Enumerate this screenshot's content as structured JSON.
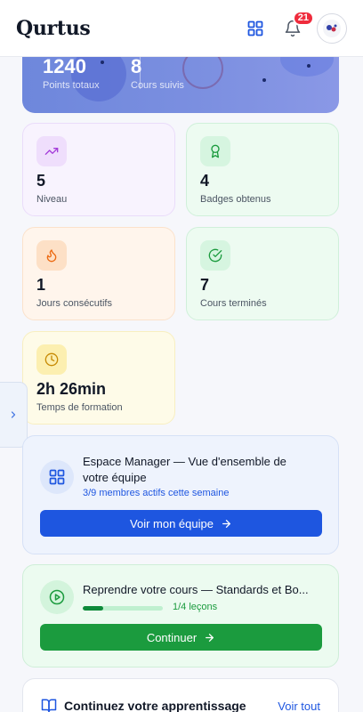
{
  "header": {
    "brand": "Qurtus",
    "notification_count": "21",
    "icons": {
      "apps": "grid-icon",
      "notifications": "bell-icon",
      "avatar": "avatar-logo"
    }
  },
  "hero": {
    "total_points_value": "1240",
    "total_points_label": "Points totaux",
    "courses_followed_value": "8",
    "courses_followed_label": "Cours suivis"
  },
  "stats": {
    "level": {
      "value": "5",
      "label": "Niveau",
      "icon": "trending-up-icon"
    },
    "badges": {
      "value": "4",
      "label": "Badges obtenus",
      "icon": "award-icon"
    },
    "streak": {
      "value": "1",
      "label": "Jours consécutifs",
      "icon": "flame-icon"
    },
    "completed": {
      "value": "7",
      "label": "Cours terminés",
      "icon": "check-circle-icon"
    },
    "training_time": {
      "value": "2h 26min",
      "label": "Temps de formation",
      "icon": "clock-icon"
    }
  },
  "manager": {
    "title": "Espace Manager — Vue d'ensemble de votre équipe",
    "subtitle": "3/9 membres actifs cette semaine",
    "button_label": "Voir mon équipe"
  },
  "resume": {
    "title": "Reprendre votre cours — Standards et Bo...",
    "progress_text": "1/4 leçons",
    "progress_fraction": 0.25,
    "button_label": "Continuer"
  },
  "continue_learning": {
    "title": "Continuez votre apprentissage",
    "link_label": "Voir tout"
  },
  "colors": {
    "primary_blue": "#1e56e0",
    "primary_green": "#1b9b3e",
    "badge_red": "#ef2b3c"
  }
}
